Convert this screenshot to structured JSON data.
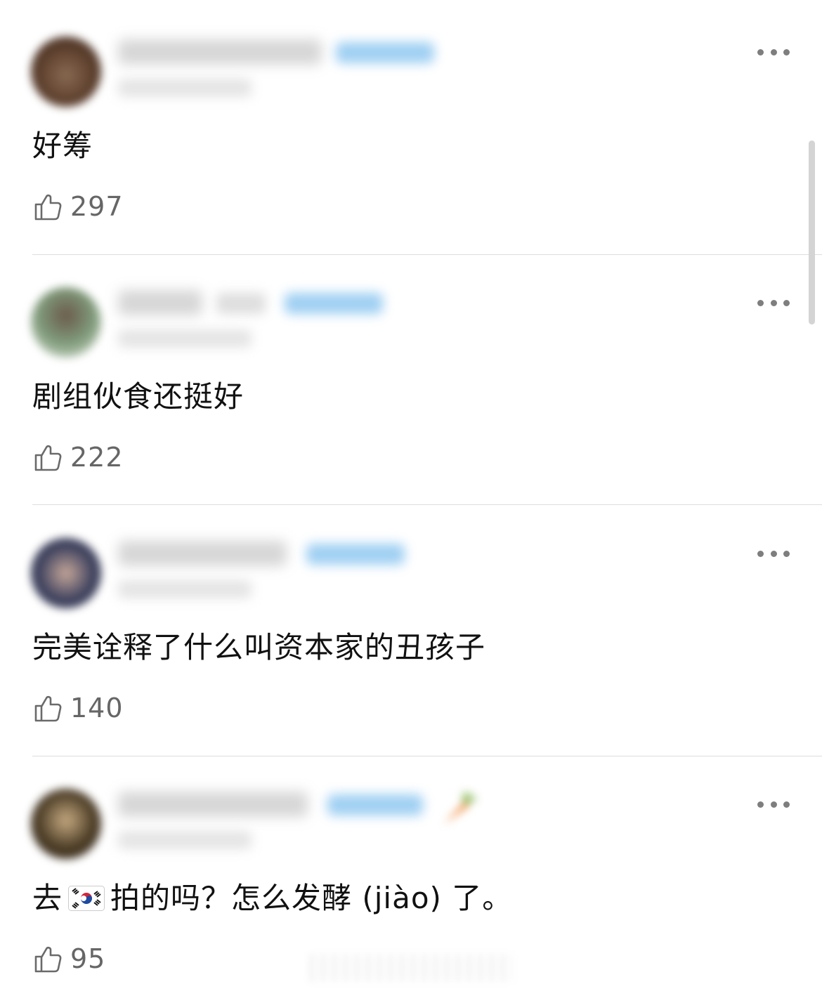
{
  "comments": [
    {
      "text": "好筹",
      "likes": "297",
      "avatar_color": "#5a3d2b"
    },
    {
      "text": "剧组伙食还挺好",
      "likes": "222",
      "avatar_color": "#5f7a5e"
    },
    {
      "text": "完美诠释了什么叫资本家的丑孩子",
      "likes": "140",
      "avatar_color": "#3f4360"
    },
    {
      "text_before": "去",
      "text_after": "拍的吗？怎么发酵 (jiào) 了。",
      "flag_icon": "south-korea-flag-icon",
      "likes": "95",
      "avatar_color": "#4a3b25"
    }
  ],
  "icons": {
    "like": "thumbs-up-icon",
    "more": "more-horizontal-icon"
  },
  "colors": {
    "verified_tag": "#8ec7f0",
    "divider": "#dddddd",
    "like_count": "#666666"
  }
}
